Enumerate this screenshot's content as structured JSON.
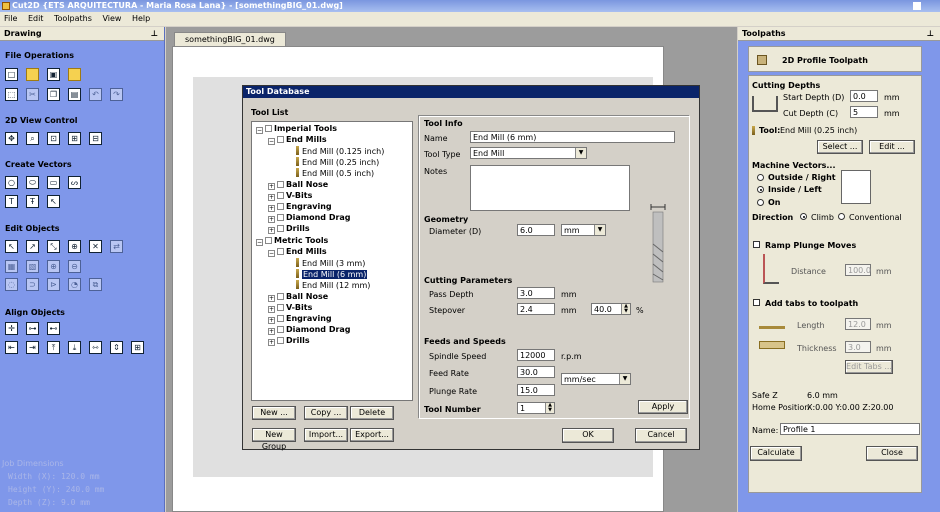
{
  "window": {
    "title": "Cut2D {ETS ARQUITECTURA - Maria Rosa Lana} - [somethingBIG_01.dwg]"
  },
  "menu": [
    "File",
    "Edit",
    "Toolpaths",
    "View",
    "Help"
  ],
  "left_panel": {
    "header": "Drawing",
    "sections": {
      "file_ops": "File Operations",
      "view": "2D View Control",
      "vectors": "Create Vectors",
      "edit": "Edit Objects",
      "align": "Align Objects"
    },
    "job": {
      "title": "Job Dimensions",
      "width": "Width  (X): 120.0 mm",
      "height": "Height (Y): 240.0 mm",
      "depth": "Depth  (Z): 9.0 mm"
    }
  },
  "document_tab": "somethingBIG_01.dwg",
  "right_panel": {
    "header": "Toolpaths",
    "toolpath_title": "2D Profile Toolpath",
    "cutting_depths": "Cutting Depths",
    "start_depth_label": "Start Depth (D)",
    "start_depth": "0.0",
    "cut_depth_label": "Cut Depth (C)",
    "cut_depth": "5",
    "unit": "mm",
    "tool_prefix": "Tool:",
    "tool": "End Mill (0.25 inch)",
    "select_btn": "Select ...",
    "edit_btn": "Edit ...",
    "machine_vectors": "Machine Vectors...",
    "outside": "Outside / Right",
    "inside": "Inside / Left",
    "on": "On",
    "direction": "Direction",
    "climb": "Climb",
    "conventional": "Conventional",
    "ramp": "Ramp Plunge Moves",
    "distance_label": "Distance",
    "distance": "100.0",
    "tabs": "Add tabs to toolpath",
    "length_label": "Length",
    "length": "12.0",
    "thickness_label": "Thickness",
    "thickness": "3.0",
    "edit_tabs": "Edit Tabs ...",
    "safe_z": "Safe Z",
    "safe_z_val": "6.0 mm",
    "home_label": "Home Position",
    "home_val": "X:0.00 Y:0.00 Z:20.00",
    "name_label": "Name:",
    "name": "Profile 1",
    "calculate": "Calculate",
    "close": "Close"
  },
  "dialog": {
    "title": "Tool Database",
    "tool_list": "Tool List",
    "tree": {
      "imperial": "Imperial Tools",
      "end_mills": "End Mills",
      "im1": "End Mill (0.125 inch)",
      "im2": "End Mill (0.25 inch)",
      "im3": "End Mill (0.5 inch)",
      "ball": "Ball Nose",
      "vbits": "V-Bits",
      "engraving": "Engraving",
      "diamond": "Diamond Drag",
      "drills": "Drills",
      "metric": "Metric Tools",
      "mm1": "End Mill (3 mm)",
      "mm2": "End Mill (6 mm)",
      "mm3": "End Mill (12 mm)"
    },
    "buttons": {
      "new": "New ...",
      "copy": "Copy ...",
      "delete": "Delete",
      "new_group": "New Group",
      "import": "Import...",
      "export": "Export...",
      "apply": "Apply",
      "ok": "OK",
      "cancel": "Cancel"
    },
    "info": {
      "title": "Tool Info",
      "name_label": "Name",
      "name": "End Mill (6 mm)",
      "type_label": "Tool Type",
      "type": "End Mill",
      "notes_label": "Notes",
      "geometry": "Geometry",
      "diameter_label": "Diameter (D)",
      "diameter": "6.0",
      "diam_unit": "mm",
      "cutting": "Cutting Parameters",
      "pass_label": "Pass Depth",
      "pass": "3.0",
      "pass_unit": "mm",
      "stepover_label": "Stepover",
      "stepover": "2.4",
      "stepover_unit": "mm",
      "stepover_pct": "40.0",
      "pct": "%",
      "feeds": "Feeds and Speeds",
      "spindle_label": "Spindle Speed",
      "spindle": "12000",
      "rpm": "r.p.m",
      "feed_label": "Feed Rate",
      "feed": "30.0",
      "rate_unit": "mm/sec",
      "plunge_label": "Plunge Rate",
      "plunge": "15.0",
      "toolnum_label": "Tool Number",
      "toolnum": "1"
    }
  }
}
